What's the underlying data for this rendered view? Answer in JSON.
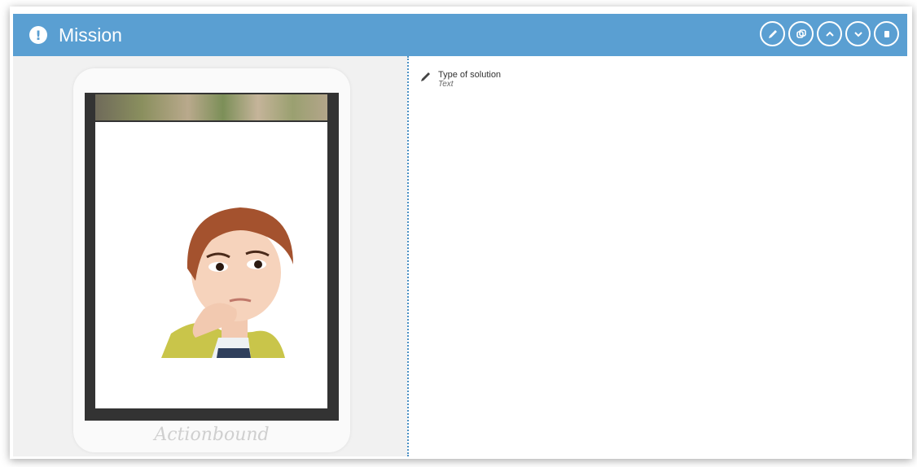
{
  "header": {
    "title": "Mission",
    "color": "#5a9fd2",
    "actions": [
      {
        "name": "edit-icon"
      },
      {
        "name": "duplicate-icon"
      },
      {
        "name": "chevron-up-icon"
      },
      {
        "name": "chevron-down-icon"
      },
      {
        "name": "delete-icon"
      }
    ]
  },
  "preview": {
    "brand": "Actionbound"
  },
  "solution": {
    "label": "Type of solution",
    "value": "Text"
  }
}
